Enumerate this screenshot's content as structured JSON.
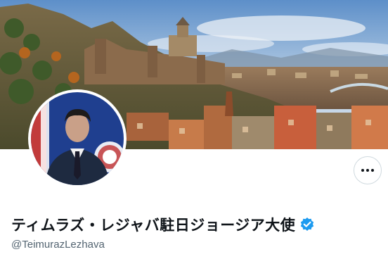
{
  "profile": {
    "display_name": "ティムラズ・レジャバ駐日ジョージア大使",
    "handle": "@TeimurazLezhava",
    "verified": true,
    "verified_color": "#1d9bf0"
  },
  "banner": {
    "description_icon": "tbilisi-cityscape-image"
  },
  "actions": {
    "more_icon": "more-options-icon"
  },
  "colors": {
    "name_text": "#0f1419",
    "handle_text": "#536471",
    "button_border": "#cfd9de"
  }
}
